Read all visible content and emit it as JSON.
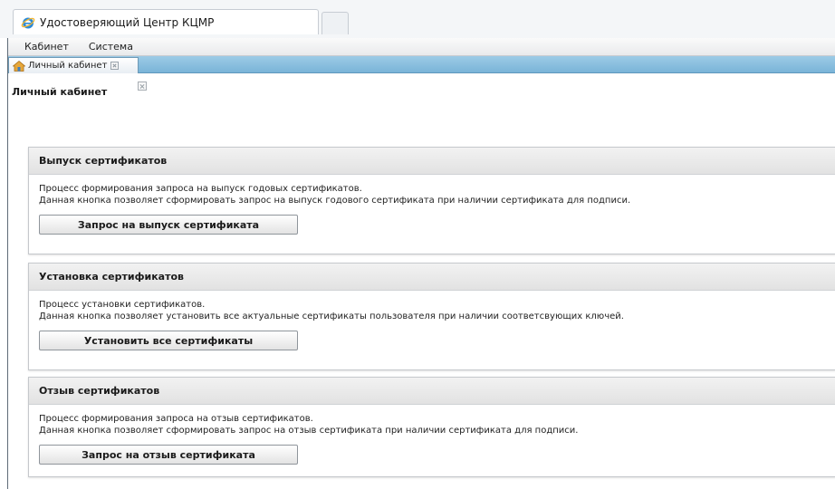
{
  "browser": {
    "tab_title": "Удостоверяющий Центр КЦМР",
    "tab_icon": "internet-explorer-icon"
  },
  "menubar": {
    "items": [
      "Кабинет",
      "Система"
    ]
  },
  "tabbar": {
    "active_tab": "Личный кабинет",
    "tab_icon": "home-icon"
  },
  "page": {
    "title": "Личный кабинет"
  },
  "panels": [
    {
      "title": "Выпуск сертификатов",
      "lines": [
        "Процесс формирования запроса на выпуск годовых сертификатов.",
        "Данная кнопка позволяет сформировать запрос на выпуск годового сертификата при наличии сертификата для подписи."
      ],
      "button": "Запрос на выпуск сертификата"
    },
    {
      "title": "Установка сертификатов",
      "lines": [
        "Процесс установки сертификатов.",
        "Данная кнопка позволяет установить все актуальные сертификаты пользователя при наличии соответсвующих ключей."
      ],
      "button": "Установить все сертификаты"
    },
    {
      "title": "Отзыв сертификатов",
      "lines": [
        "Процесс формирования запроса на отзыв сертификатов.",
        "Данная кнопка позволяет сформировать запрос на отзыв сертификата при наличии сертификата для подписи."
      ],
      "button": "Запрос на отзыв сертификата"
    }
  ],
  "colors": {
    "tabbar_blue": "#8fc2e2",
    "panel_header": "#e6e6e6",
    "frame_border": "#5f6b77"
  }
}
